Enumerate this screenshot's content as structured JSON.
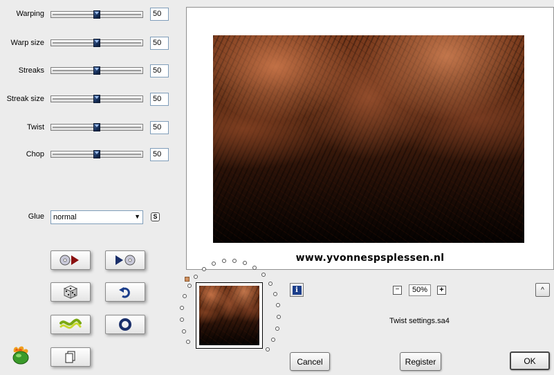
{
  "sliders": [
    {
      "label": "Warping",
      "value": "50",
      "fraction": 0.5
    },
    {
      "label": "Warp size",
      "value": "50",
      "fraction": 0.5
    },
    {
      "label": "Streaks",
      "value": "50",
      "fraction": 0.5
    },
    {
      "label": "Streak size",
      "value": "50",
      "fraction": 0.5
    },
    {
      "label": "Twist",
      "value": "50",
      "fraction": 0.5
    },
    {
      "label": "Chop",
      "value": "50",
      "fraction": 0.5
    }
  ],
  "glue": {
    "label": "Glue",
    "value": "normal",
    "s_button": "S"
  },
  "preview": {
    "watermark": "www.yvonnespsplessen.nl"
  },
  "zoom": {
    "level": "50%",
    "minus": "−",
    "plus": "+"
  },
  "info_icon": "i",
  "collapse_button": "^",
  "settings_file": "Twist settings.sa4",
  "buttons": {
    "cancel": "Cancel",
    "register": "Register",
    "ok": "OK"
  },
  "colors": {
    "accent": "#18325e",
    "preview_bg": "#ffffff",
    "texture_dark": "#050201",
    "texture_light": "#cd784b"
  }
}
